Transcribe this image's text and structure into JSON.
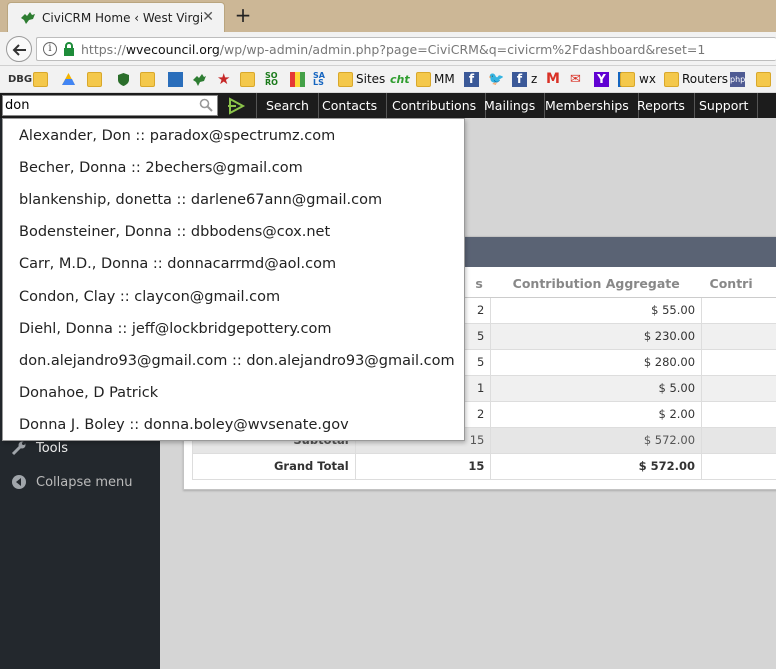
{
  "browser": {
    "tab_title": "CiviCRM Home ‹ West Virgin",
    "url_prefix": "https://",
    "url_host": "wvecouncil.org",
    "url_path": "/wp/wp-admin/admin.php?page=CiviCRM&q=civicrm%2Fdashboard&reset=1"
  },
  "bookmarks": {
    "sites": "Sites",
    "mm": "MM",
    "z": "z",
    "wx": "wx",
    "routers": "Routers",
    "so_ro": "SO RO",
    "sa_ls": "SA LS"
  },
  "civicrm_menu": {
    "search_value": "don",
    "items": [
      "Search",
      "Contacts",
      "Contributions",
      "Mailings",
      "Memberships",
      "Reports",
      "Support"
    ]
  },
  "autocomplete": [
    "Alexander, Don :: paradox@spectrumz.com",
    "Becher, Donna :: 2bechers@gmail.com",
    "blankenship, donetta :: darlene67ann@gmail.com",
    "Bodensteiner, Donna :: dbbodens@cox.net",
    "Carr, M.D., Donna :: donnacarrmd@aol.com",
    "Condon, Clay :: claycon@gmail.com",
    "Diehl, Donna :: jeff@lockbridgepottery.com",
    "don.alejandro93@gmail.com :: don.alejandro93@gmail.com",
    "Donahoe, D Patrick",
    "Donna J. Boley :: donna.boley@wvsenate.gov"
  ],
  "wp_sidebar": {
    "tools": "Tools",
    "collapse": "Collapse menu"
  },
  "contrib_table": {
    "headers": [
      "",
      "s",
      "Contribution Aggregate",
      "Contri"
    ],
    "rows": [
      {
        "count": "2",
        "aggregate": "$ 55.00"
      },
      {
        "count": "5",
        "aggregate": "$ 230.00"
      },
      {
        "count": "5",
        "aggregate": "$ 280.00"
      },
      {
        "count": "1",
        "aggregate": "$ 5.00"
      },
      {
        "count": "2",
        "aggregate": "$ 2.00"
      }
    ],
    "subtotal": {
      "label": "Subtotal",
      "count": "15",
      "aggregate": "$ 572.00"
    },
    "grand_total": {
      "label": "Grand Total",
      "count": "15",
      "aggregate": "$ 572.00"
    }
  },
  "colors": {
    "tabstrip": "#ccb796",
    "civinav": "#1c1c1c",
    "wp_sidebar": "#23282d",
    "card_header": "#5a6374"
  }
}
